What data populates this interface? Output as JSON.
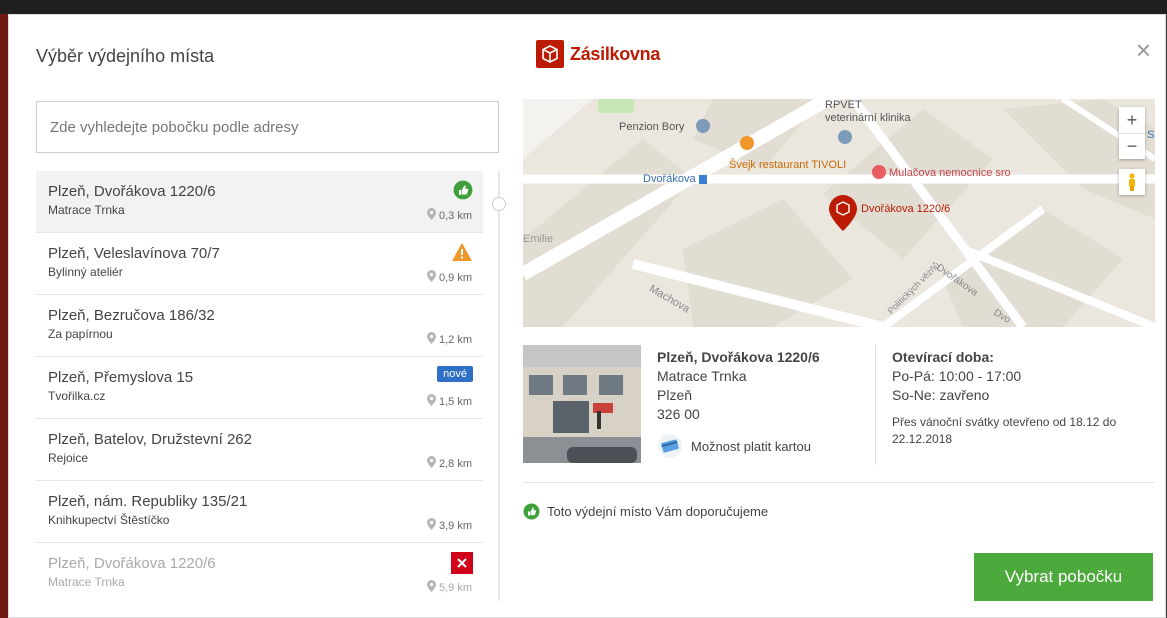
{
  "header": {
    "title": "Výběr výdejního místa",
    "brand": "Zásilkovna",
    "close": "×"
  },
  "search": {
    "placeholder": "Zde vyhledejte pobočku podle adresy",
    "value": ""
  },
  "branches": [
    {
      "name": "Plzeň, Dvořákova 1220/6",
      "subtitle": "Matrace Trnka",
      "distance": "0,3 km",
      "badge": "recommended-icon",
      "active": true
    },
    {
      "name": "Plzeň, Veleslavínova 70/7",
      "subtitle": "Bylinný ateliér",
      "distance": "0,9 km",
      "badge": "warning-icon"
    },
    {
      "name": "Plzeň, Bezručova 186/32",
      "subtitle": "Za papírnou",
      "distance": "1,2 km",
      "badge": ""
    },
    {
      "name": "Plzeň, Přemyslova 15",
      "subtitle": "Tvořilka.cz",
      "distance": "1,5 km",
      "badge": "new",
      "badge_label": "nové"
    },
    {
      "name": "Plzeň, Batelov, Družstevní 262",
      "subtitle": "Rejoice",
      "distance": "2,8 km",
      "badge": ""
    },
    {
      "name": "Plzeň, nám. Republiky 135/21",
      "subtitle": "Knihkupectví Štěstíčko",
      "distance": "3,9 km",
      "badge": ""
    },
    {
      "name": "Plzeň, Dvořákova 1220/6",
      "subtitle": "Matrace Trnka",
      "distance": "5,9 km",
      "badge": "closed-icon",
      "disabled": true
    }
  ],
  "map": {
    "labels": {
      "rpvet": "RPVET",
      "vet": "veterinární klinika",
      "penzion": "Penzion Bory",
      "svejk": "Švejk restaurant TIVOLI",
      "mulac": "Mulačova nemocnice sro",
      "dvorakova_stop": "Dvořákova",
      "pin": "Dvořákova 1220/6",
      "emilie": "Emilie",
      "machova": "Machova",
      "politickych": "Politických vězňů",
      "dvorakova_st": "Dvořákova",
      "dvor2": "Dvo",
      "edge_s": "S"
    },
    "zoom_in": "+",
    "zoom_out": "−"
  },
  "detail": {
    "name": "Plzeň, Dvořákova 1220/6",
    "place": "Matrace Trnka",
    "city": "Plzeň",
    "zip": "326 00",
    "card": "Možnost platit kartou"
  },
  "hours": {
    "title": "Otevírací doba:",
    "weekdays": "Po-Pá: 10:00 - 17:00",
    "weekend": "So-Ne: zavřeno",
    "note": "Přes vánoční svátky otevřeno od 18.12 do 22.12.2018"
  },
  "recommend": "Toto výdejní místo Vám doporučujeme",
  "select_button": "Vybrat pobočku",
  "colors": {
    "brand": "#ba1b02",
    "button": "#4caa3c",
    "new_badge": "#2f6fc6",
    "warning": "#f0962a",
    "closed": "#d0021b"
  }
}
